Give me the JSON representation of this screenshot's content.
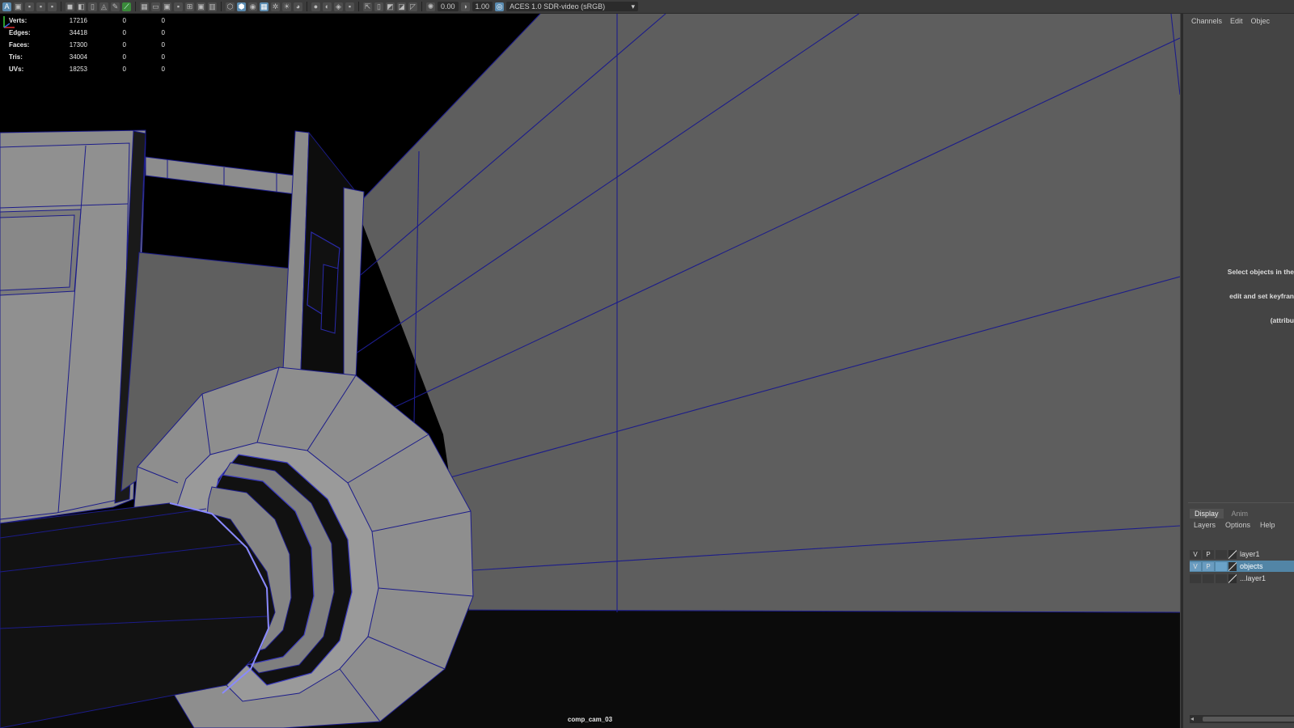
{
  "toolbar": {
    "icons": [
      "select-tool-icon",
      "lasso-icon",
      "paint-icon",
      "camera-icon",
      "bookmark-icon",
      "grid-icon",
      "wireframe-icon",
      "shaded-icon",
      "texture-icon",
      "light-icon",
      "shadow-icon",
      "isolate-icon",
      "xray-icon",
      "resolution-gate-icon",
      "exposure-icon",
      "gamma-icon"
    ],
    "exposure_value": "0.00",
    "gamma_value": "1.00",
    "color_transform": "ACES 1.0 SDR-video (sRGB)"
  },
  "hud": {
    "rows": [
      {
        "label": "Verts:",
        "v1": "17216",
        "v2": "0",
        "v3": "0"
      },
      {
        "label": "Edges:",
        "v1": "34418",
        "v2": "0",
        "v3": "0"
      },
      {
        "label": "Faces:",
        "v1": "17300",
        "v2": "0",
        "v3": "0"
      },
      {
        "label": "Tris:",
        "v1": "34004",
        "v2": "0",
        "v3": "0"
      },
      {
        "label": "UVs:",
        "v1": "18253",
        "v2": "0",
        "v3": "0"
      }
    ]
  },
  "viewport": {
    "camera_name": "comp_cam_03",
    "wire_color": "#1c1c8a",
    "surface_color": "#5e5e5e"
  },
  "channel_box": {
    "menu": [
      "Channels",
      "Edit",
      "Objec"
    ],
    "hint_lines": [
      "Select objects in the",
      "edit and set keyfran",
      "(attribu"
    ]
  },
  "layer_editor": {
    "tabs": [
      "Display",
      "Anim"
    ],
    "menu": [
      "Layers",
      "Options",
      "Help"
    ],
    "layers": [
      {
        "v": "V",
        "p": "P",
        "name": "layer1",
        "selected": false
      },
      {
        "v": "V",
        "p": "P",
        "name": "objects",
        "selected": true
      },
      {
        "v": "",
        "p": "",
        "name": "...layer1",
        "selected": false
      }
    ]
  },
  "colors": {
    "accent": "#5285a6",
    "panel_bg": "#444444",
    "toolbar_bg": "#3c3c3c"
  }
}
